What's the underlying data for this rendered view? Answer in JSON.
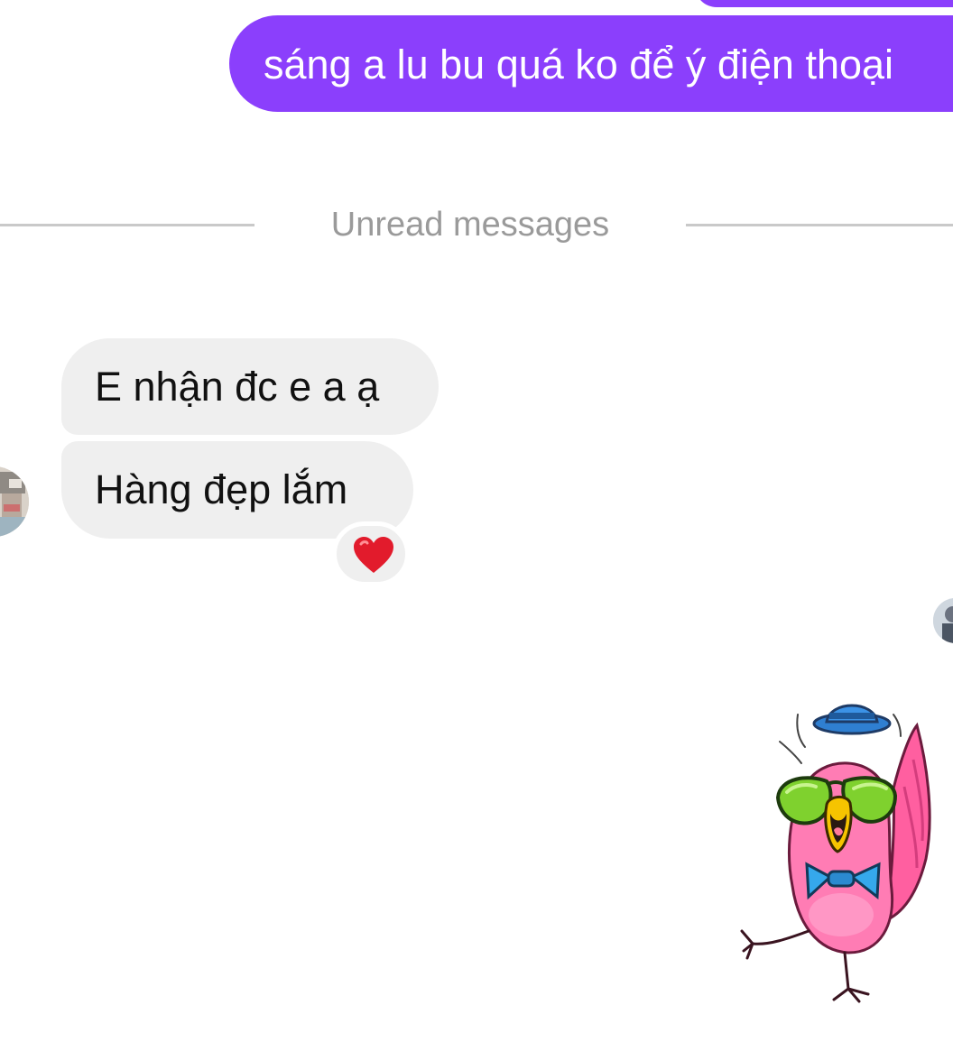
{
  "conversation": {
    "outgoing_message": "sáng a lu bu quá ko để ý điện thoại",
    "unread_divider_label": "Unread messages",
    "incoming_messages": [
      "E nhận đc e a ạ",
      "Hàng đẹp lắm"
    ],
    "reaction_emoji": "❤️",
    "reaction_icon": "heart-icon",
    "sticker_icon": "bird-sticker-icon"
  },
  "colors": {
    "outgoing_bubble": "#8b3ffc",
    "incoming_bubble": "#efefef",
    "divider_text": "#9a9a9a",
    "heart": "#e21b2c"
  }
}
